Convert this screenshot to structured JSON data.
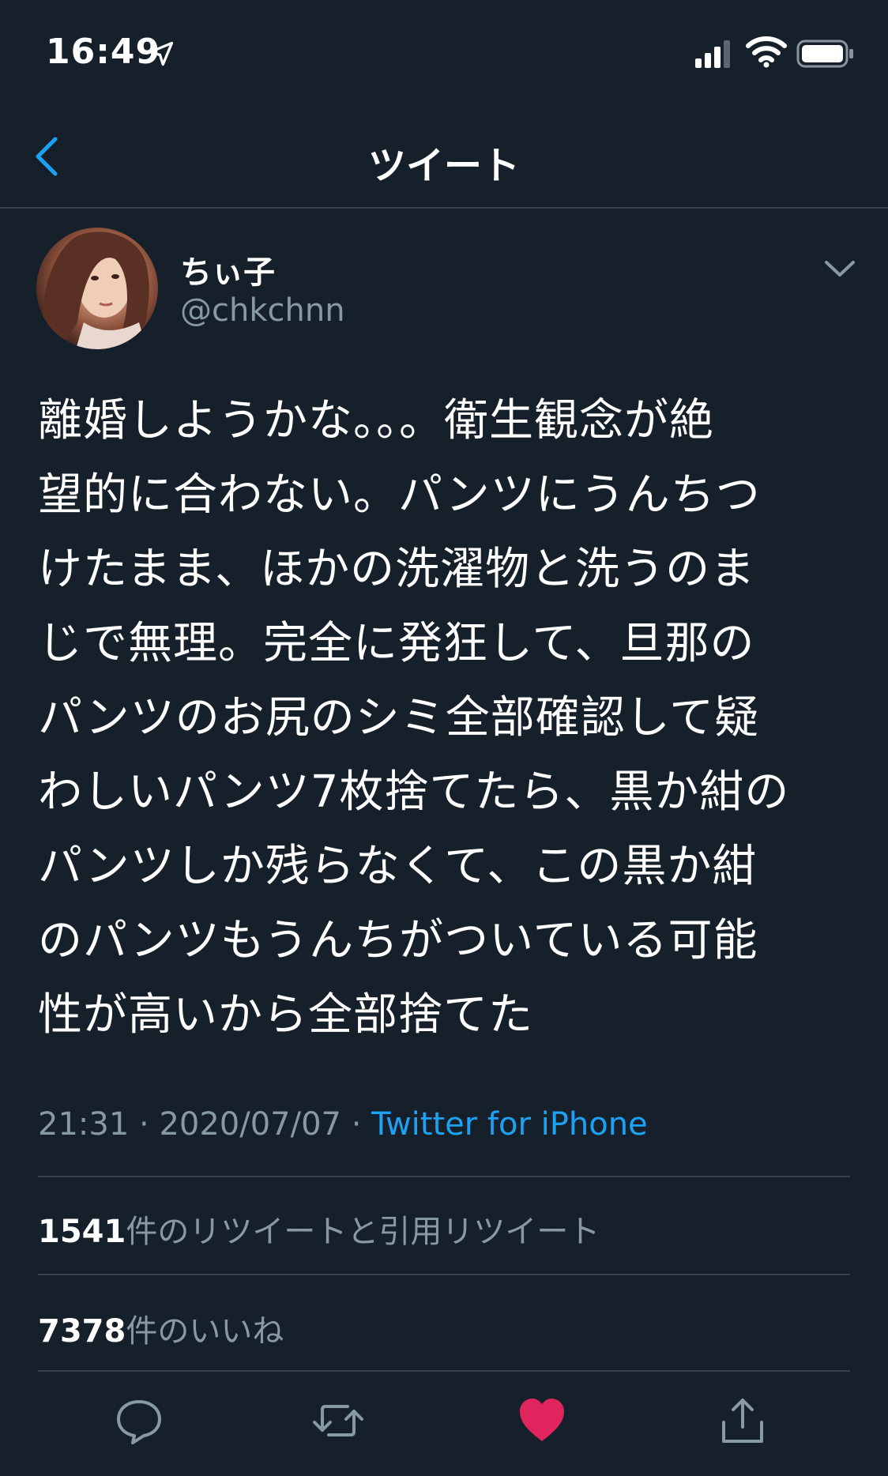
{
  "status_bar": {
    "time": "16:49"
  },
  "nav": {
    "title": "ツイート"
  },
  "tweet": {
    "author_name": "ちぃ子",
    "author_handle": "@chkchnn",
    "lines": [
      "離婚しようかな。。。衛生観念が絶",
      "望的に合わない。パンツにうんちつ",
      "けたまま、ほかの洗濯物と洗うのま",
      "じで無理。完全に発狂して、旦那の",
      "パンツのお尻のシミ全部確認して疑",
      "わしいパンツ7枚捨てたら、黒か紺の",
      "パンツしか残らなくて、この黒か紺",
      "のパンツもうんちがついている可能",
      "性が高いから全部捨てた"
    ],
    "time": "21:31",
    "date": "2020/07/07",
    "source": "Twitter for iPhone"
  },
  "stats": {
    "retweets_count": "1541",
    "retweets_label": "件のリツイートと引用リツイート",
    "likes_count": "7378",
    "likes_label": "件のいいね"
  },
  "colors": {
    "background": "#15202b",
    "accent": "#1da1f2",
    "like": "#e0245e",
    "muted": "#8899a6"
  },
  "icons": [
    "location-arrow-icon",
    "signal-icon",
    "wifi-icon",
    "battery-icon",
    "back-chevron-icon",
    "chevron-down-icon",
    "reply-icon",
    "retweet-icon",
    "like-icon",
    "share-icon"
  ]
}
